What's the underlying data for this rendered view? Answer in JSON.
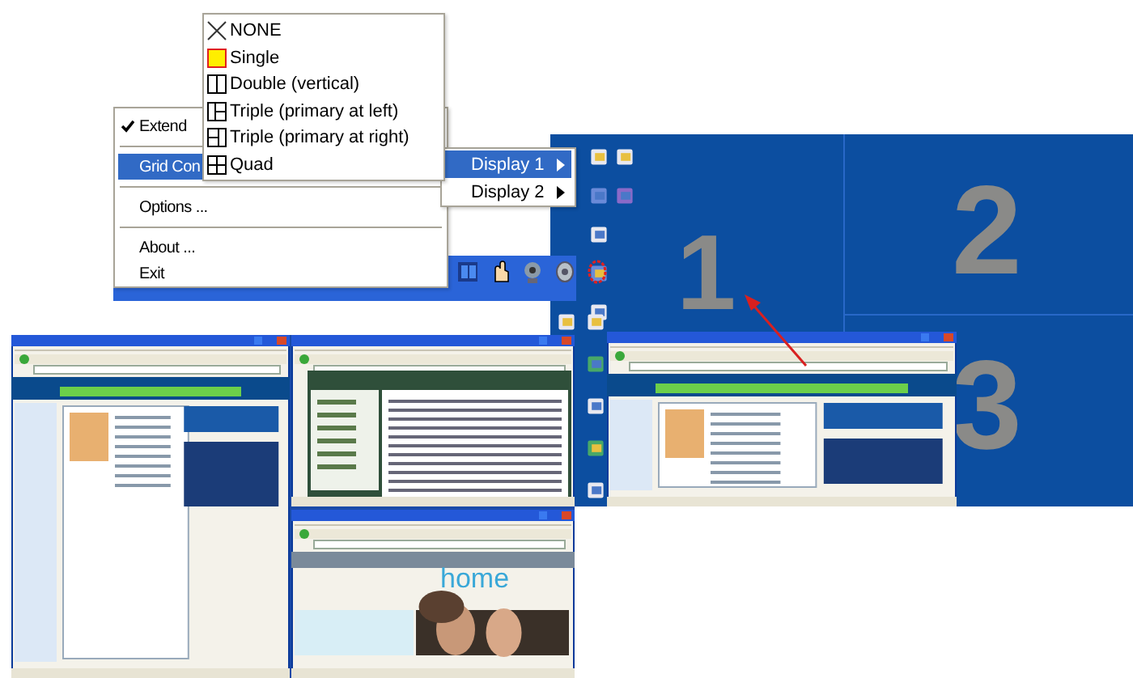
{
  "context_menu": {
    "items": [
      {
        "kind": "item",
        "label": "Extend",
        "checked": true,
        "highlighted": false
      },
      {
        "kind": "separator"
      },
      {
        "kind": "item",
        "label": "Grid Con",
        "checked": false,
        "highlighted": true
      },
      {
        "kind": "separator"
      },
      {
        "kind": "item",
        "label": "Options ...",
        "checked": false,
        "highlighted": false
      },
      {
        "kind": "separator"
      },
      {
        "kind": "item",
        "label": "About ...",
        "checked": false,
        "highlighted": false
      },
      {
        "kind": "item",
        "label": "Exit",
        "checked": false,
        "highlighted": false
      }
    ]
  },
  "grid_menu": {
    "items": [
      {
        "kind": "none",
        "label": "NONE",
        "selected": false
      },
      {
        "kind": "single",
        "label": "Single",
        "selected": true
      },
      {
        "kind": "double",
        "label": "Double (vertical)",
        "selected": false
      },
      {
        "kind": "triple_left",
        "label": "Triple (primary at left)",
        "selected": false
      },
      {
        "kind": "triple_right",
        "label": "Triple (primary at right)",
        "selected": false
      },
      {
        "kind": "quad",
        "label": "Quad",
        "selected": false
      }
    ]
  },
  "display_menu": {
    "items": [
      {
        "label": "Display 1",
        "highlighted": true
      },
      {
        "label": "Display 2",
        "highlighted": false
      }
    ]
  },
  "desktop": {
    "regions": [
      {
        "label": "1"
      },
      {
        "label": "2"
      },
      {
        "label": "3"
      }
    ]
  },
  "screenshot": {
    "site_logo": "home"
  }
}
